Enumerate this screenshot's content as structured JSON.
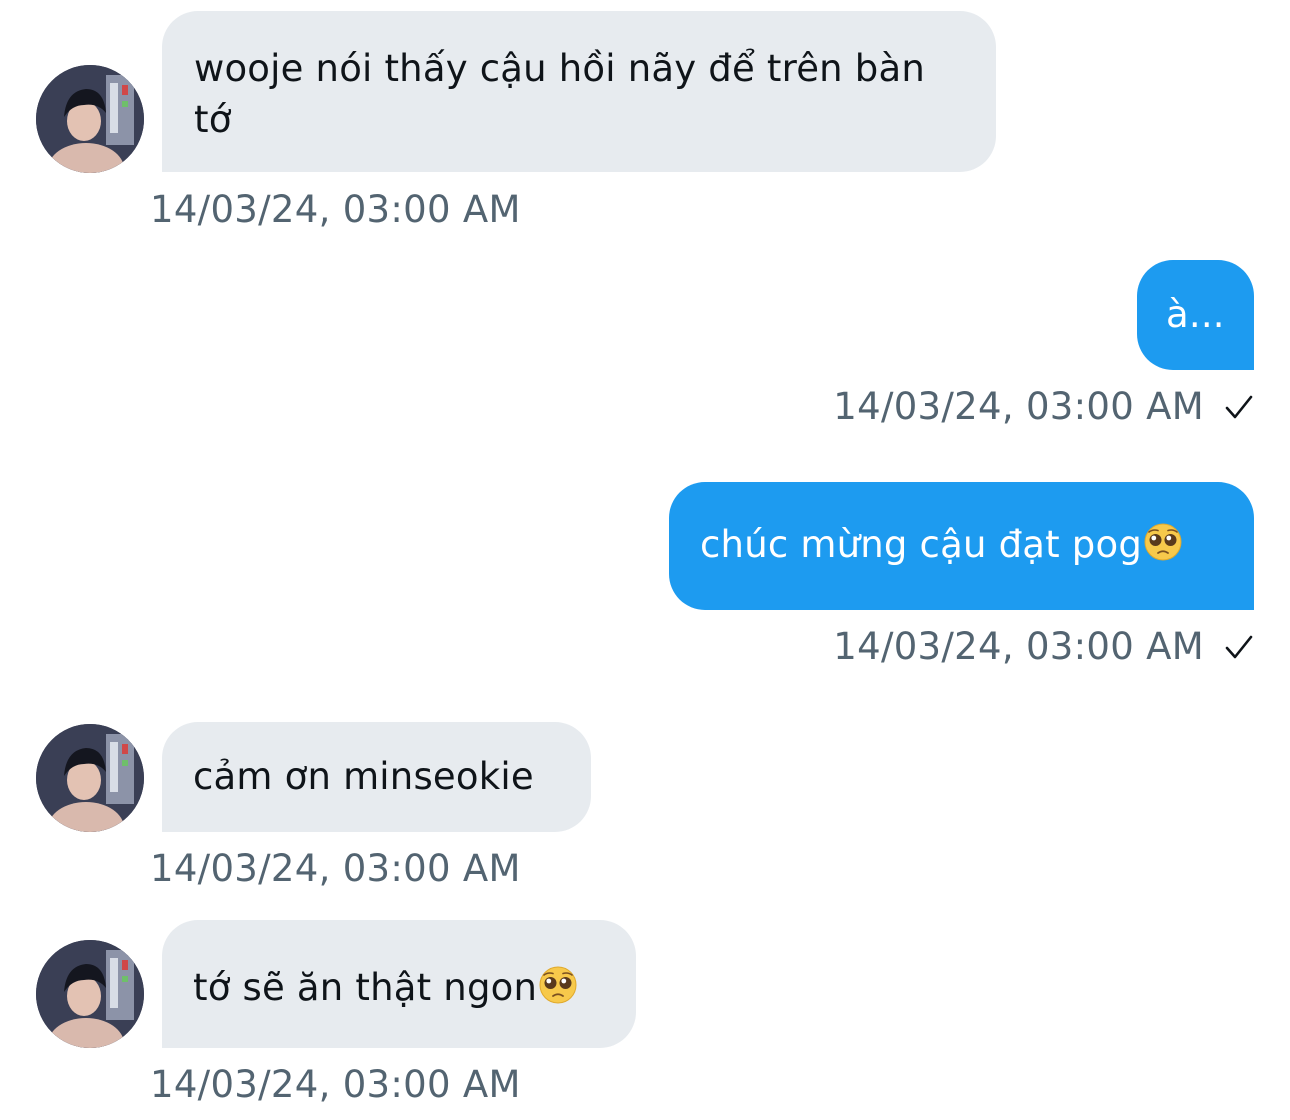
{
  "messages": [
    {
      "direction": "incoming",
      "text": "wooje nói thấy cậu hồi nãy để trên bàn tớ",
      "timestamp": "14/03/24, 03:00 AM"
    },
    {
      "direction": "outgoing",
      "text": "à...",
      "timestamp": "14/03/24, 03:00 AM",
      "status_icon": "sent-check-icon"
    },
    {
      "direction": "outgoing",
      "text": "chúc mừng cậu đạt pog",
      "emoji": "pleading-face-emoji",
      "timestamp": "14/03/24, 03:00 AM",
      "status_icon": "sent-check-icon"
    },
    {
      "direction": "incoming",
      "text": "cảm ơn minseokie",
      "timestamp": "14/03/24, 03:00 AM"
    },
    {
      "direction": "incoming",
      "text": "tớ sẽ ăn thật ngon",
      "emoji": "pleading-face-emoji",
      "timestamp": "14/03/24, 03:00 AM"
    }
  ],
  "colors": {
    "incoming_bubble": "#e7ebef",
    "outgoing_bubble": "#1d9bf0",
    "timestamp": "#536471",
    "incoming_text": "#0f1419",
    "outgoing_text": "#ffffff"
  }
}
